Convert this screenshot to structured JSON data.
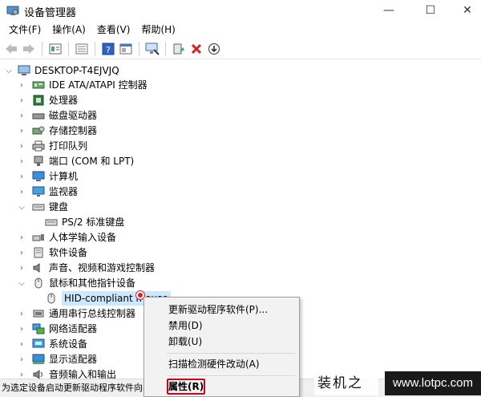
{
  "window": {
    "title": "设备管理器",
    "minimize": "—",
    "maximize": "☐",
    "close": "✕"
  },
  "menu": [
    "文件(F)",
    "操作(A)",
    "查看(V)",
    "帮助(H)"
  ],
  "tree": {
    "root": "DESKTOP-T4EJVJQ",
    "items": [
      {
        "label": "IDE ATA/ATAPI 控制器",
        "icon": "ide-controller-icon"
      },
      {
        "label": "处理器",
        "icon": "processor-icon"
      },
      {
        "label": "磁盘驱动器",
        "icon": "disk-drive-icon"
      },
      {
        "label": "存储控制器",
        "icon": "storage-controller-icon"
      },
      {
        "label": "打印队列",
        "icon": "printer-icon"
      },
      {
        "label": "端口 (COM 和 LPT)",
        "icon": "port-icon"
      },
      {
        "label": "计算机",
        "icon": "computer-icon"
      },
      {
        "label": "监视器",
        "icon": "monitor-icon"
      },
      {
        "label": "键盘",
        "icon": "keyboard-icon"
      },
      {
        "label": "PS/2 标准键盘",
        "icon": "keyboard-icon"
      },
      {
        "label": "人体学输入设备",
        "icon": "hid-icon"
      },
      {
        "label": "软件设备",
        "icon": "software-device-icon"
      },
      {
        "label": "声音、视频和游戏控制器",
        "icon": "sound-icon"
      },
      {
        "label": "鼠标和其他指针设备",
        "icon": "mouse-icon"
      },
      {
        "label": "HID-compliant mouse",
        "icon": "mouse-icon"
      },
      {
        "label": "通用串行总线控制器",
        "icon": "usb-icon"
      },
      {
        "label": "网络适配器",
        "icon": "network-icon"
      },
      {
        "label": "系统设备",
        "icon": "system-device-icon"
      },
      {
        "label": "显示适配器",
        "icon": "display-adapter-icon"
      },
      {
        "label": "音频输入和输出",
        "icon": "audio-icon"
      }
    ]
  },
  "context_menu": {
    "update_driver": "更新驱动程序软件(P)...",
    "disable": "禁用(D)",
    "uninstall": "卸载(U)",
    "scan": "扫描检测硬件改动(A)",
    "properties": "属性(R)"
  },
  "statusbar": "为选定设备启动更新驱动程序软件向导。",
  "watermark": {
    "name": "装机之家",
    "url": "www.lotpc.com"
  },
  "colors": {
    "selection": "#cce8ff",
    "highlight_box": "#d0021b"
  }
}
